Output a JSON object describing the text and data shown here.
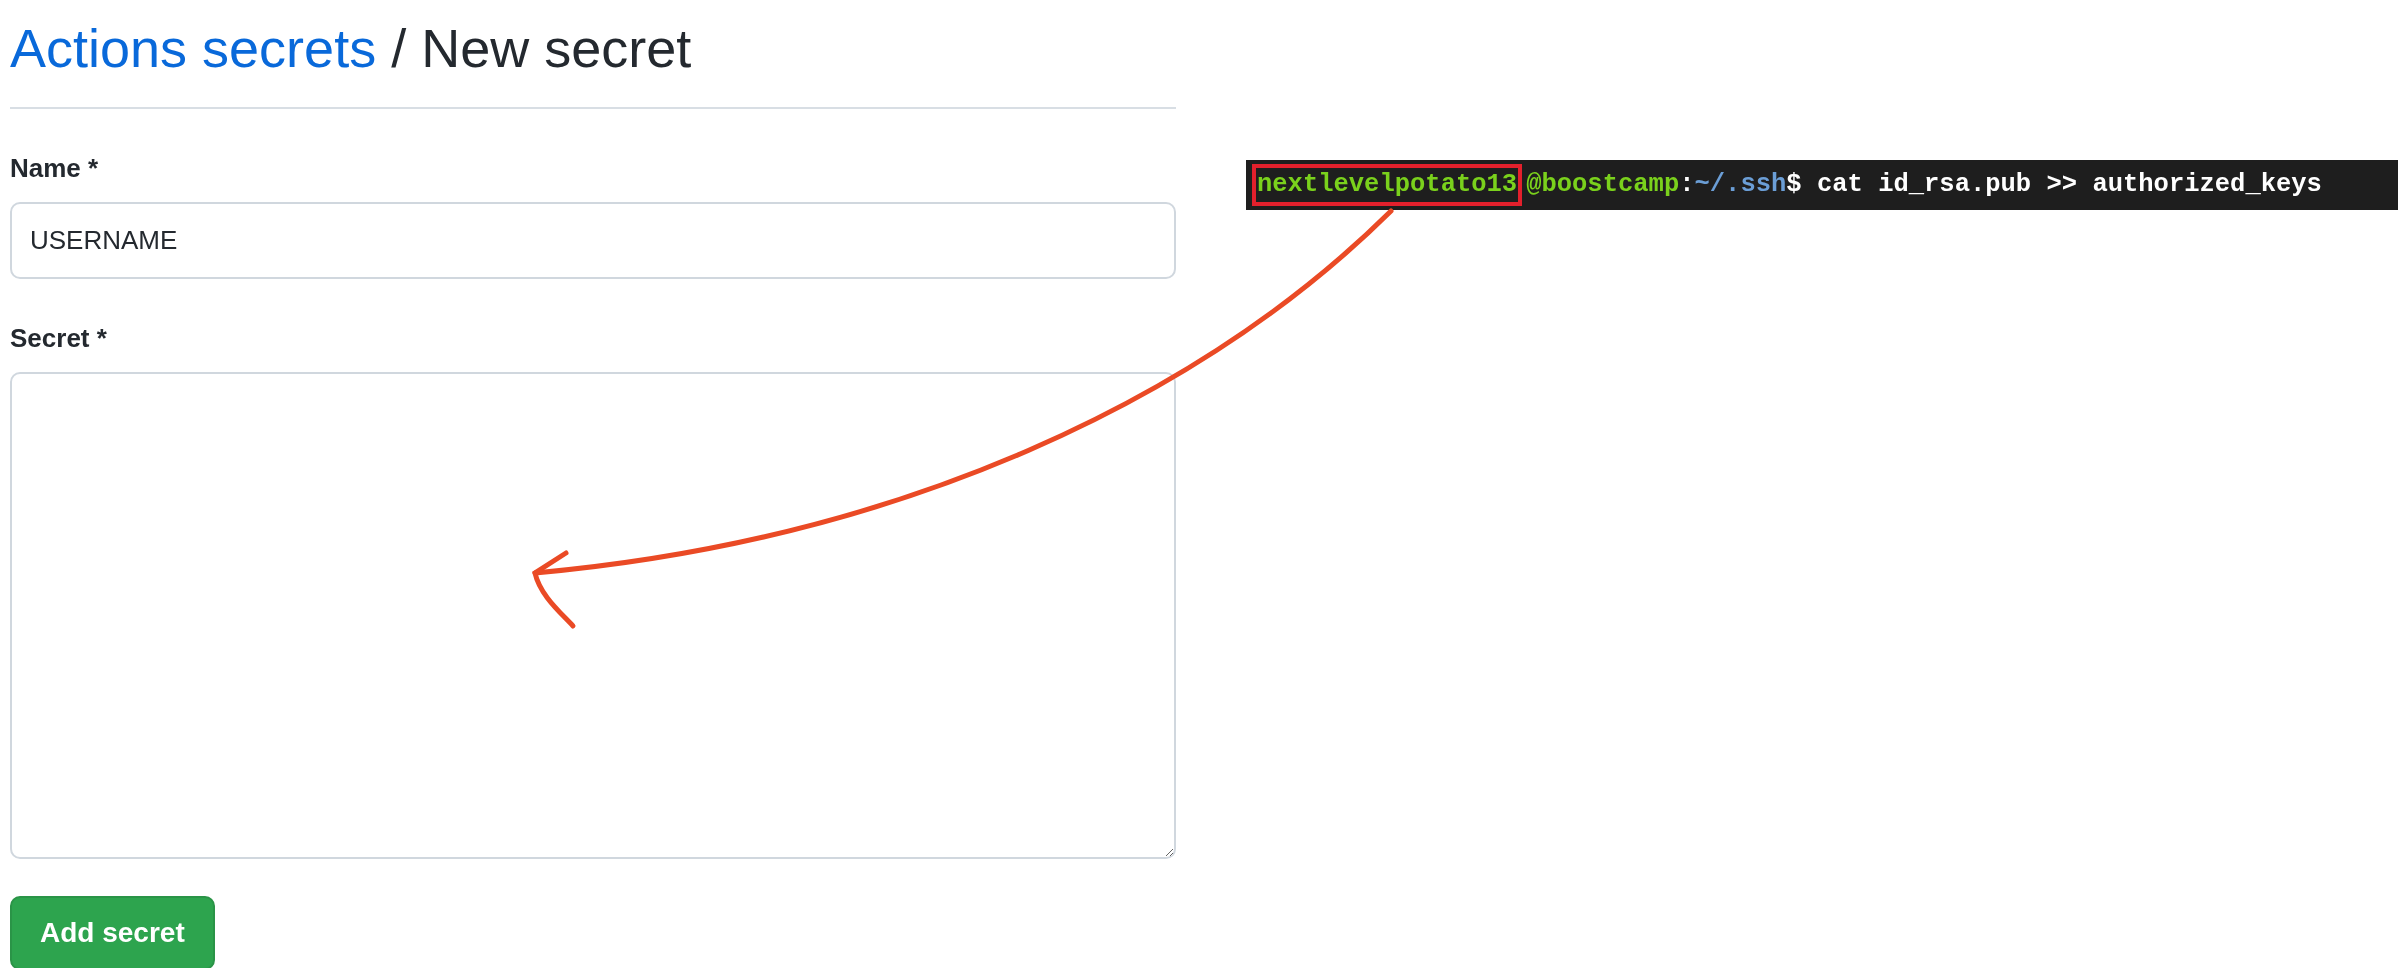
{
  "breadcrumb": {
    "link": "Actions secrets",
    "separator": "/",
    "current": "New secret"
  },
  "form": {
    "fields": [
      {
        "kind": "input",
        "label": "Name *",
        "value": "USERNAME"
      },
      {
        "kind": "textarea",
        "label": "Secret *"
      }
    ],
    "submit": "Add secret"
  },
  "terminal": {
    "segments": [
      {
        "kind": "user",
        "text": "nextlevelpotato13",
        "highlighted": true
      },
      {
        "kind": "host",
        "text": "@boostcamp",
        "highlighted": false
      },
      {
        "kind": "plain",
        "text": ":",
        "highlighted": false
      },
      {
        "kind": "path",
        "text": "~/.ssh",
        "highlighted": false
      },
      {
        "kind": "plain",
        "text": "$ cat id_rsa.pub >> authorized_keys",
        "highlighted": false
      }
    ]
  }
}
